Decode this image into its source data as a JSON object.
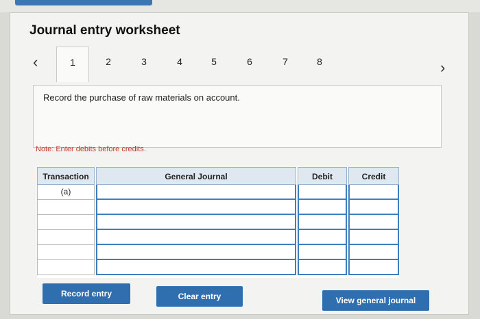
{
  "title": "Journal entry worksheet",
  "nav": {
    "prev_icon": "‹",
    "next_icon": "›",
    "steps": [
      "1",
      "2",
      "3",
      "4",
      "5",
      "6",
      "7",
      "8"
    ]
  },
  "instruction": "Record the purchase of raw materials on account.",
  "note": "Note: Enter debits before credits.",
  "table": {
    "headers": {
      "transaction": "Transaction",
      "general_journal": "General Journal",
      "debit": "Debit",
      "credit": "Credit"
    },
    "rows": [
      {
        "transaction": "(a)"
      },
      {
        "transaction": ""
      },
      {
        "transaction": ""
      },
      {
        "transaction": ""
      },
      {
        "transaction": ""
      },
      {
        "transaction": ""
      }
    ]
  },
  "buttons": {
    "record": "Record entry",
    "clear": "Clear entry",
    "view": "View general journal"
  }
}
